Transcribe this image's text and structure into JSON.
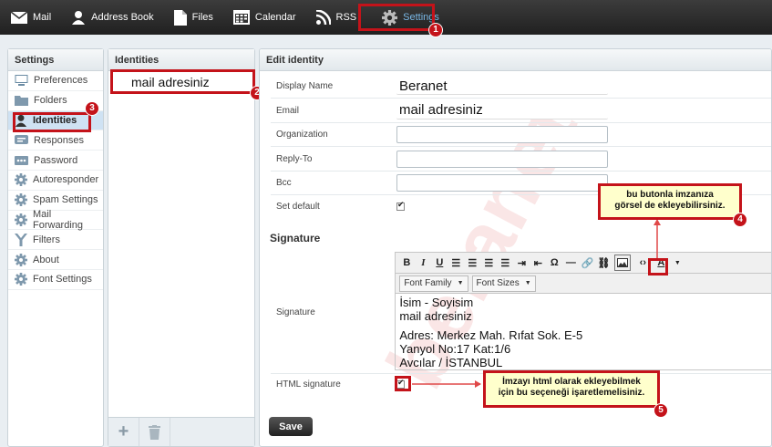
{
  "topbar": {
    "items": [
      {
        "label": "Mail",
        "icon": "mail-icon"
      },
      {
        "label": "Address Book",
        "icon": "person-icon"
      },
      {
        "label": "Files",
        "icon": "file-icon"
      },
      {
        "label": "Calendar",
        "icon": "calendar-icon"
      },
      {
        "label": "RSS",
        "icon": "rss-icon"
      },
      {
        "label": "Settings",
        "icon": "gear-icon",
        "active": true
      }
    ]
  },
  "sidebar": {
    "title": "Settings",
    "items": [
      {
        "label": "Preferences",
        "icon": "monitor-icon"
      },
      {
        "label": "Folders",
        "icon": "folder-icon"
      },
      {
        "label": "Identities",
        "icon": "person-icon",
        "active": true
      },
      {
        "label": "Responses",
        "icon": "response-icon"
      },
      {
        "label": "Password",
        "icon": "key-icon"
      },
      {
        "label": "Autoresponder",
        "icon": "gear-icon"
      },
      {
        "label": "Spam Settings",
        "icon": "gear-icon"
      },
      {
        "label": "Mail Forwarding",
        "icon": "gear-icon"
      },
      {
        "label": "Filters",
        "icon": "filter-icon"
      },
      {
        "label": "About",
        "icon": "gear-icon"
      },
      {
        "label": "Font Settings",
        "icon": "gear-icon"
      }
    ]
  },
  "identities": {
    "title": "Identities",
    "items": [
      "mail adresiniz"
    ]
  },
  "edit": {
    "title": "Edit identity",
    "display_name_label": "Display Name",
    "display_name_value": "Beranet",
    "email_label": "Email",
    "email_value": "mail adresiniz",
    "organization_label": "Organization",
    "reply_to_label": "Reply-To",
    "bcc_label": "Bcc",
    "set_default_label": "Set default",
    "signature_heading": "Signature",
    "signature_label": "Signature",
    "html_signature_label": "HTML signature",
    "font_family": "Font Family",
    "font_sizes": "Font Sizes",
    "signature_lines": [
      "İsim - Soyisim",
      "mail adresiniz",
      "Adres: Merkez Mah. Rıfat Sok. E-5",
      "Yanyol No:17 Kat:1/6",
      "Avcılar / İSTANBUL"
    ],
    "save_label": "Save"
  },
  "annotations": {
    "callout_image": [
      "bu butonla imzanıza",
      "görsel de ekleyebilirsiniz."
    ],
    "callout_html": [
      "İmzayı html olarak ekleyebilmek",
      "için bu seçeneği işaretlemelisiniz."
    ],
    "badges": [
      "1",
      "2",
      "3",
      "4",
      "5"
    ],
    "accent": "#c4131a"
  },
  "watermark": "beranet"
}
